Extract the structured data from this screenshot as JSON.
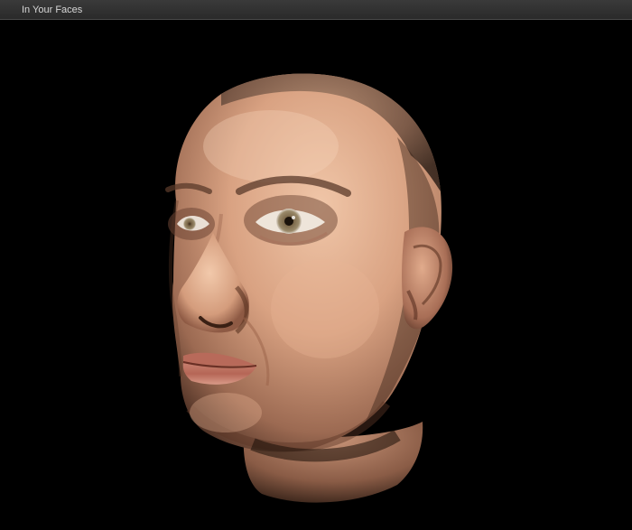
{
  "window": {
    "title": "In Your Faces"
  },
  "viewport": {
    "background_color": "#000000",
    "subject": "3d-head-model",
    "skin_color": "#d29c7f"
  }
}
